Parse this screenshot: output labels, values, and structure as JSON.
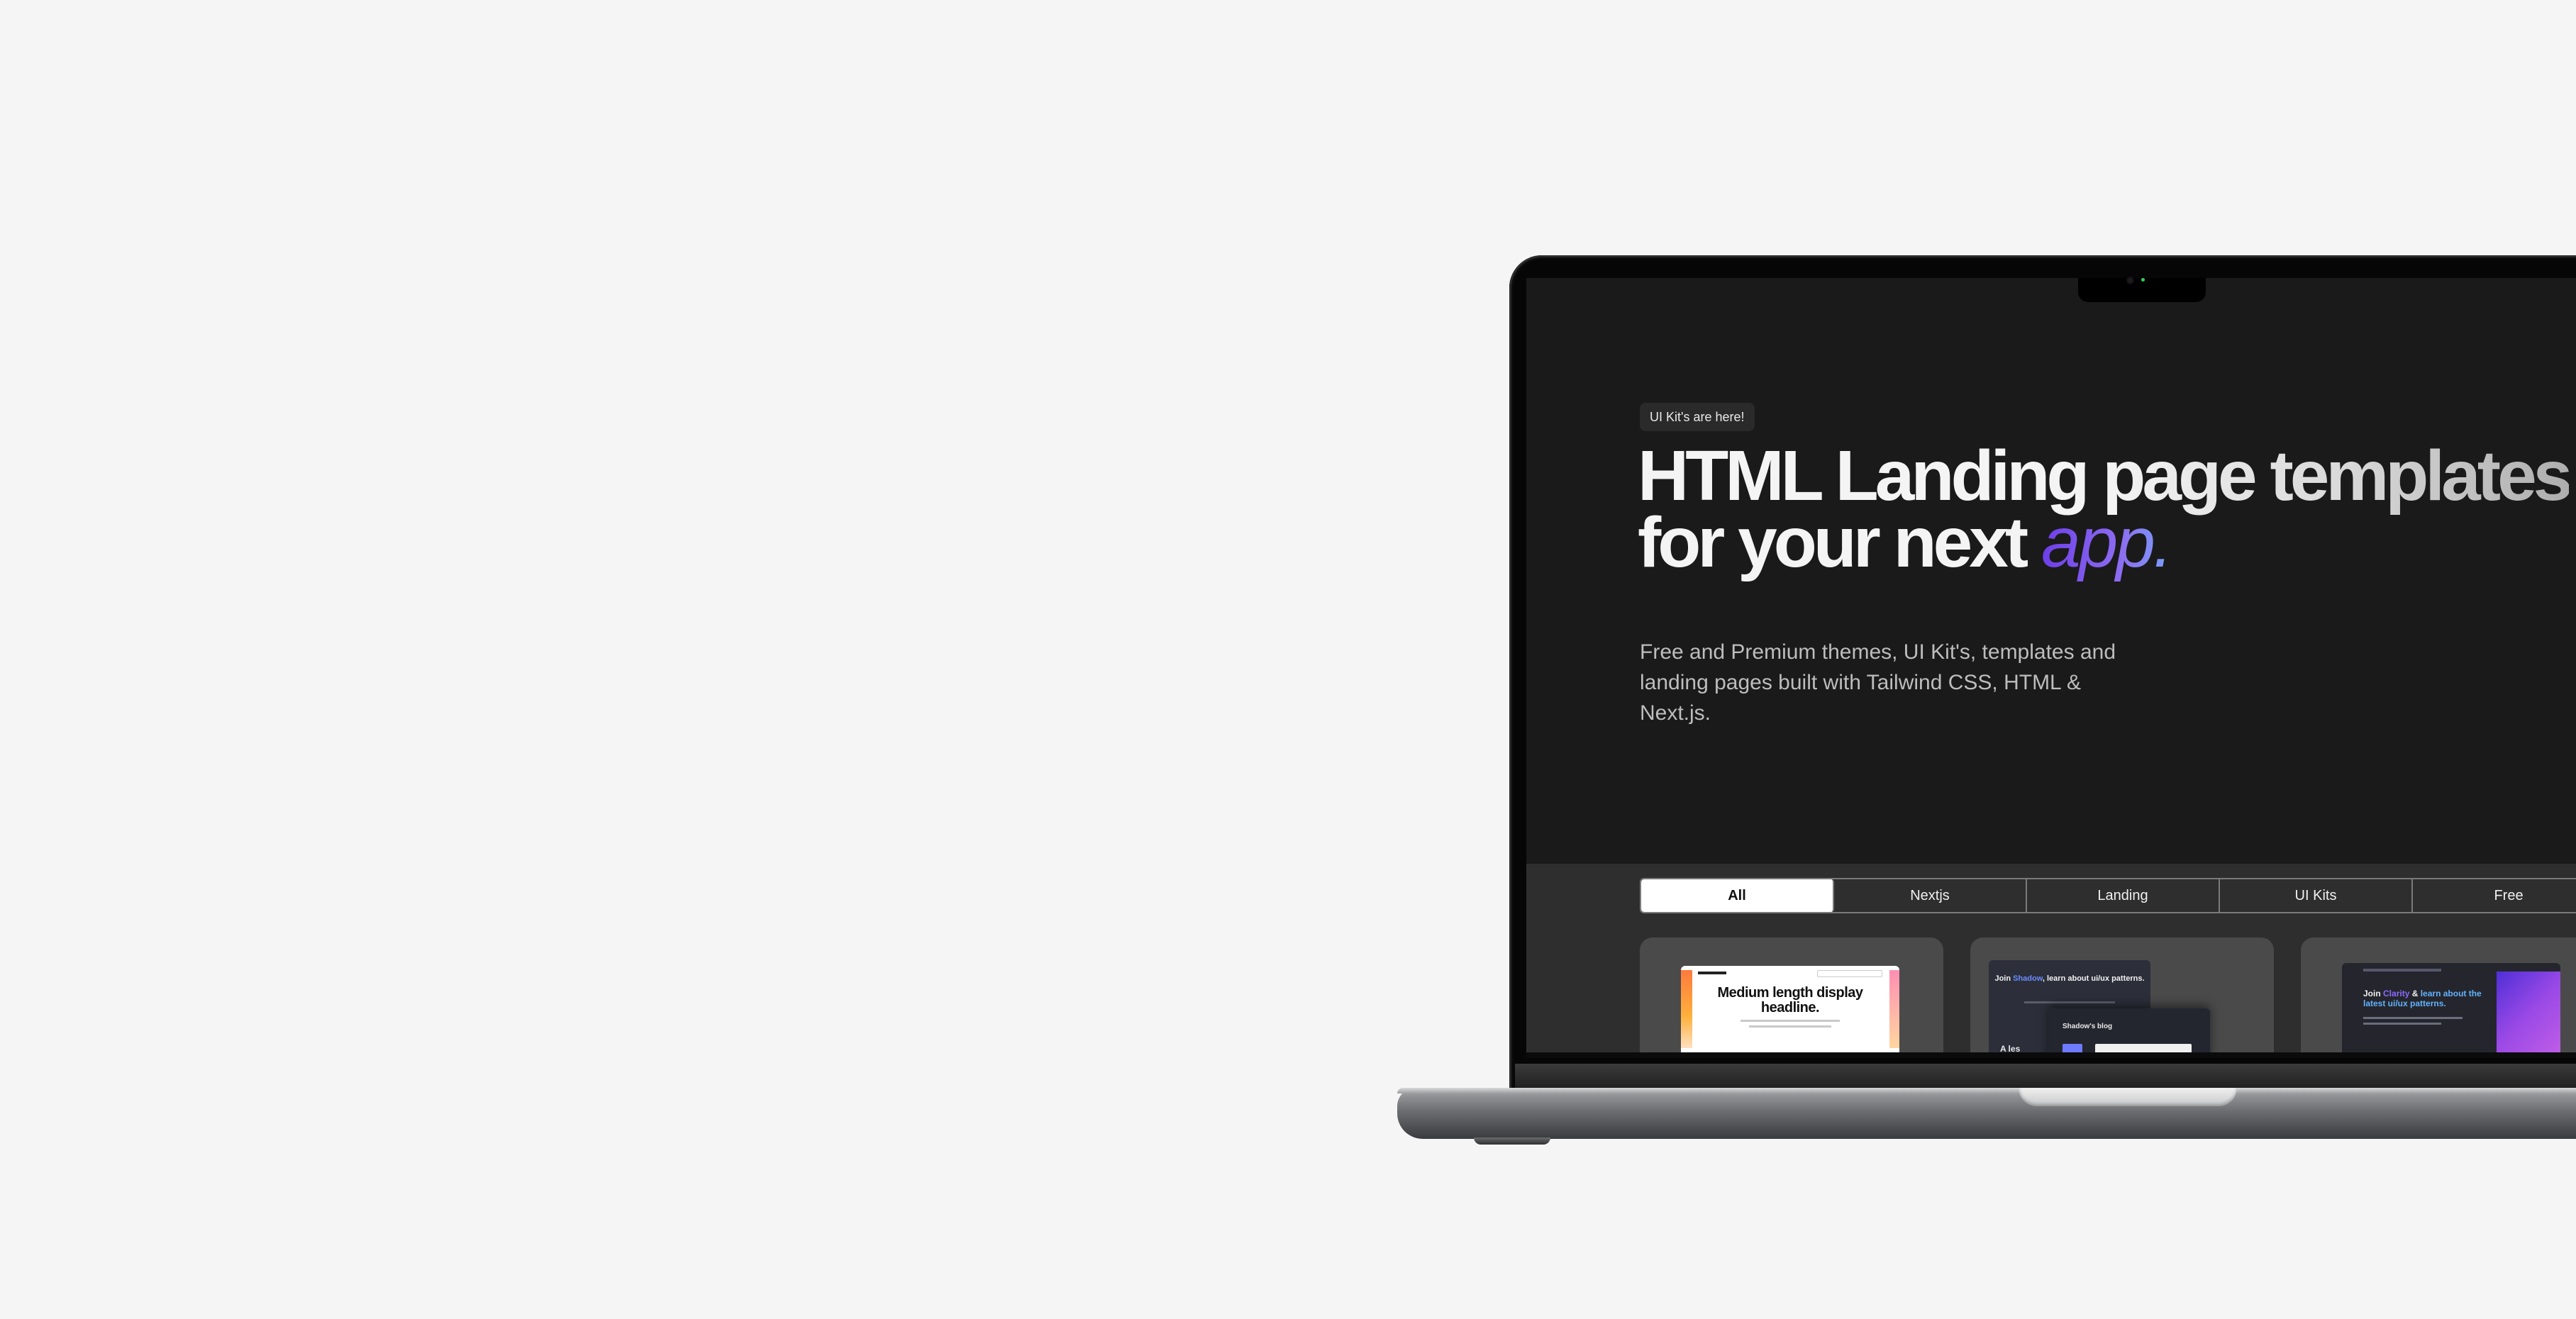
{
  "hero": {
    "badge": "UI Kit's are here!",
    "headline_line1_part1": "HTML Landing ",
    "headline_line1_part2": "page templates",
    "headline_line2_part1": "for your next ",
    "headline_line2_accent": "app.",
    "subtitle": "Free and Premium themes, UI Kit's, templates and landing pages built with Tailwind CSS, HTML & Next.js."
  },
  "filters": {
    "tabs": [
      "All",
      "Nextjs",
      "Landing",
      "UI Kits",
      "Free"
    ],
    "active": "All"
  },
  "cards": [
    {
      "preview_title": "Medium length display headline."
    },
    {
      "preview_title_pre": "Join ",
      "preview_title_accent": "Shadow",
      "preview_title_post": ", learn about ui/ux patterns.",
      "preview_sub": "Shadow's blog",
      "preview_small": "A les"
    },
    {
      "preview_title_pre": "Join ",
      "preview_title_accent1": "Clarity",
      "preview_title_mid": " & ",
      "preview_title_accent2": "learn about the latest ui/ux patterns."
    }
  ],
  "colors": {
    "page_background": "#f5f5f5",
    "screen_background": "#1a1a1a",
    "gallery_background": "#2e2e2e",
    "card_background": "#4a4a4a",
    "accent_purple": "#6d3ee8",
    "accent_blue": "#7aa0f7"
  }
}
